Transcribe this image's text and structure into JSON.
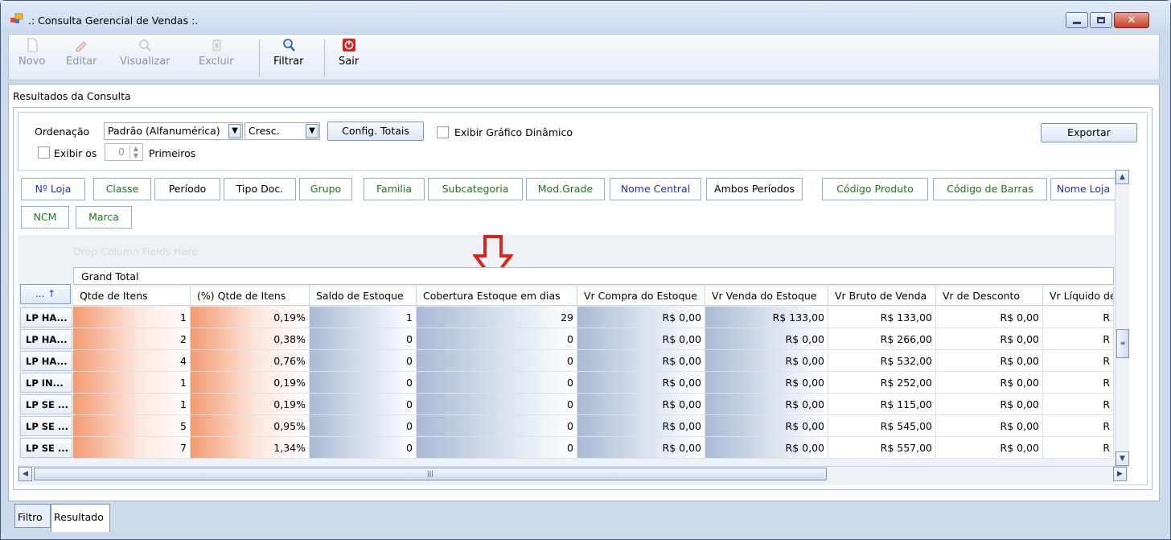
{
  "window": {
    "title": ".: Consulta Gerencial de Vendas :."
  },
  "toolbar": {
    "novo": "Novo",
    "editar": "Editar",
    "visualizar": "Visualizar",
    "excluir": "Excluir",
    "filtrar": "Filtrar",
    "sair": "Sair"
  },
  "group": {
    "title": "Resultados da Consulta"
  },
  "options": {
    "ordenacao_label": "Ordenação",
    "ordenacao_value": "Padrão (Alfanumérica)",
    "direction_value": "Cresc.",
    "config_totais": "Config. Totais",
    "exibir_grafico": "Exibir Gráfico Dinâmico",
    "exportar": "Exportar",
    "exibir_os": "Exibir os",
    "primeiros_count": "0",
    "primeiros": "Primeiros"
  },
  "pivot": {
    "fields": [
      {
        "label": "Nº Loja",
        "color": "blue"
      },
      {
        "label": "Classe",
        "color": "green"
      },
      {
        "label": "Período",
        "color": "black"
      },
      {
        "label": "Tipo Doc.",
        "color": "black"
      },
      {
        "label": "Grupo",
        "color": "green"
      },
      {
        "label": "Familia",
        "color": "green"
      },
      {
        "label": "Subcategoria",
        "color": "green"
      },
      {
        "label": "Mod.Grade",
        "color": "green"
      },
      {
        "label": "Nome Central",
        "color": "blue"
      },
      {
        "label": "Ambos Períodos",
        "color": "black"
      },
      {
        "label": "Código Produto",
        "color": "green"
      },
      {
        "label": "Código de Barras",
        "color": "green"
      },
      {
        "label": "Nome Loja",
        "color": "blue"
      },
      {
        "label": "NCM",
        "color": "green"
      },
      {
        "label": "Marca",
        "color": "green"
      }
    ],
    "drop_hint": "Drop Column Fields Here",
    "grand_total": "Grand Total",
    "corner": "... ↑",
    "columns": [
      "Qtde de Itens",
      "(%) Qtde de Itens",
      "Saldo de Estoque",
      "Cobertura Estoque em dias",
      "Vr Compra do Estoque",
      "Vr Venda do Estoque",
      "Vr Bruto de Venda",
      "Vr de Desconto",
      "Vr Líquido de"
    ],
    "rows": [
      {
        "label": "LP HA...",
        "cells": [
          "1",
          "0,19%",
          "1",
          "29",
          "R$ 0,00",
          "R$ 133,00",
          "R$ 133,00",
          "R$ 0,00",
          "R"
        ]
      },
      {
        "label": "LP HA...",
        "cells": [
          "2",
          "0,38%",
          "0",
          "0",
          "R$ 0,00",
          "R$ 0,00",
          "R$ 266,00",
          "R$ 0,00",
          "R"
        ]
      },
      {
        "label": "LP HA...",
        "cells": [
          "4",
          "0,76%",
          "0",
          "0",
          "R$ 0,00",
          "R$ 0,00",
          "R$ 532,00",
          "R$ 0,00",
          "R"
        ]
      },
      {
        "label": "LP IN...",
        "cells": [
          "1",
          "0,19%",
          "0",
          "0",
          "R$ 0,00",
          "R$ 0,00",
          "R$ 252,00",
          "R$ 0,00",
          "R"
        ]
      },
      {
        "label": "LP SE ...",
        "cells": [
          "1",
          "0,19%",
          "0",
          "0",
          "R$ 0,00",
          "R$ 0,00",
          "R$ 115,00",
          "R$ 0,00",
          "R"
        ]
      },
      {
        "label": "LP SE ...",
        "cells": [
          "5",
          "0,95%",
          "0",
          "0",
          "R$ 0,00",
          "R$ 0,00",
          "R$ 545,00",
          "R$ 0,00",
          "R"
        ]
      },
      {
        "label": "LP SE ...",
        "cells": [
          "7",
          "1,34%",
          "0",
          "0",
          "R$ 0,00",
          "R$ 0,00",
          "R$ 557,00",
          "R$ 0,00",
          "R"
        ]
      }
    ]
  },
  "tabs": {
    "filtro": "Filtro",
    "resultado": "Resultado"
  },
  "colors": {
    "accent_red": "#d9261c",
    "field_blue": "#1e2fd4",
    "field_green": "#1a7a1a"
  }
}
